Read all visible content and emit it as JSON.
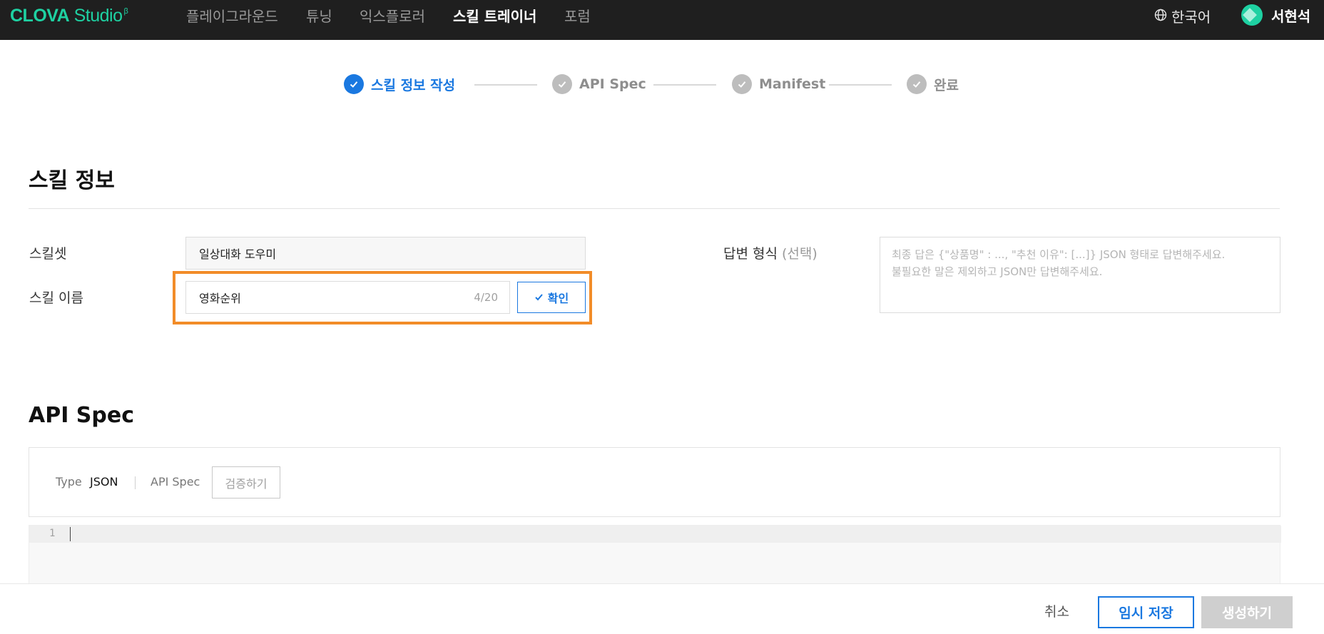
{
  "app": {
    "logo_brand": "CLOVA",
    "logo_product": "Studio",
    "logo_beta": "β",
    "nav": [
      {
        "label": "플레이그라운드",
        "active": false
      },
      {
        "label": "튜닝",
        "active": false
      },
      {
        "label": "익스플로러",
        "active": false
      },
      {
        "label": "스킬 트레이너",
        "active": true
      },
      {
        "label": "포럼",
        "active": false
      }
    ],
    "language": "한국어",
    "user_name": "서현석"
  },
  "stepper": {
    "steps": [
      {
        "label": "스킬 정보 작성",
        "status": "active"
      },
      {
        "label": "API Spec",
        "status": "pending"
      },
      {
        "label": "Manifest",
        "status": "pending"
      },
      {
        "label": "완료",
        "status": "pending"
      }
    ]
  },
  "skill_info": {
    "title": "스킬 정보",
    "skillset_label": "스킬셋",
    "skillset_value": "일상대화 도우미",
    "name_label": "스킬 이름",
    "name_value": "영화순위",
    "name_counter": "4/20",
    "confirm_label": "확인",
    "answer_format_label": "답변 형식",
    "answer_format_optional": "(선택)",
    "answer_format_placeholder_line1": "최종 답은 {\"상품명\" : ..., \"추천 이유\": [...]} JSON 형태로 답변해주세요.",
    "answer_format_placeholder_line2": "불필요한 말은 제외하고 JSON만 답변해주세요."
  },
  "api_spec": {
    "title": "API Spec",
    "type_label": "Type",
    "type_value": "JSON",
    "spec_label": "API Spec",
    "validate_label": "검증하기",
    "line_number": "1"
  },
  "footer": {
    "cancel_label": "취소",
    "save_label": "임시 저장",
    "create_label": "생성하기"
  },
  "colors": {
    "brand": "#1ed1a2",
    "accent": "#1a78e0",
    "highlight": "#f28c28",
    "topbar": "#1f1f1f",
    "disabled": "#cfcfcf"
  }
}
